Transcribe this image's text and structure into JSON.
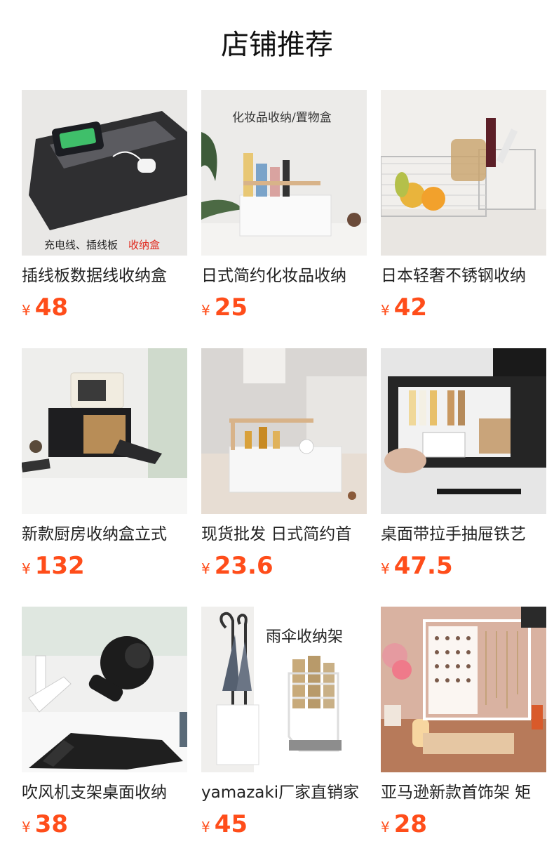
{
  "section": {
    "title": "店铺推荐"
  },
  "currency_symbol": "¥",
  "accent_color": "#ff4d1a",
  "products": [
    {
      "name": "插线板数据线收纳盒",
      "price": "48",
      "image_text": [
        "充电线、插线板",
        "收纳盒"
      ]
    },
    {
      "name": "日式简约化妆品收纳",
      "price": "25",
      "image_text": [
        "化妆品收纳/置物盒"
      ]
    },
    {
      "name": "日本轻奢不锈钢收纳",
      "price": "42",
      "image_text": []
    },
    {
      "name": "新款厨房收纳盒立式",
      "price": "132",
      "image_text": []
    },
    {
      "name": "现货批发 日式简约首",
      "price": "23.6",
      "image_text": []
    },
    {
      "name": "桌面带拉手抽屉铁艺",
      "price": "47.5",
      "image_text": []
    },
    {
      "name": "吹风机支架桌面收纳",
      "price": "38",
      "image_text": []
    },
    {
      "name": "yamazaki厂家直销家",
      "price": "45",
      "image_text": [
        "雨伞收纳架"
      ]
    },
    {
      "name": "亚马逊新款首饰架 矩",
      "price": "28",
      "image_text": []
    }
  ]
}
